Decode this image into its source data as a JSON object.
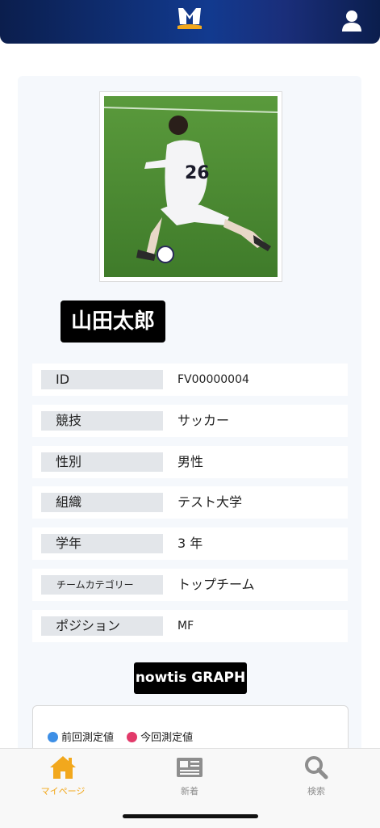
{
  "profile": {
    "name": "山田太郎",
    "fields": [
      {
        "label": "ID",
        "value": "FV00000004"
      },
      {
        "label": "競技",
        "value": "サッカー"
      },
      {
        "label": "性別",
        "value": "男性"
      },
      {
        "label": "組織",
        "value": "テスト大学"
      },
      {
        "label": "学年",
        "value": "3 年"
      },
      {
        "label": "チームカテゴリー",
        "value": "トップチーム"
      },
      {
        "label": "ポジション",
        "value": "MF"
      }
    ],
    "jersey_number": "26"
  },
  "graph": {
    "button_label": "nowtis GRAPH",
    "legend": [
      {
        "label": "前回測定値",
        "color": "#3d8fe6"
      },
      {
        "label": "今回測定値",
        "color": "#e23a6a"
      }
    ]
  },
  "tabbar": {
    "items": [
      {
        "label": "マイページ",
        "icon": "home-icon",
        "active": true
      },
      {
        "label": "新着",
        "icon": "news-icon",
        "active": false
      },
      {
        "label": "検索",
        "icon": "search-icon",
        "active": false
      }
    ],
    "active_color": "#f2a81d",
    "inactive_color": "#8e8e8e"
  }
}
